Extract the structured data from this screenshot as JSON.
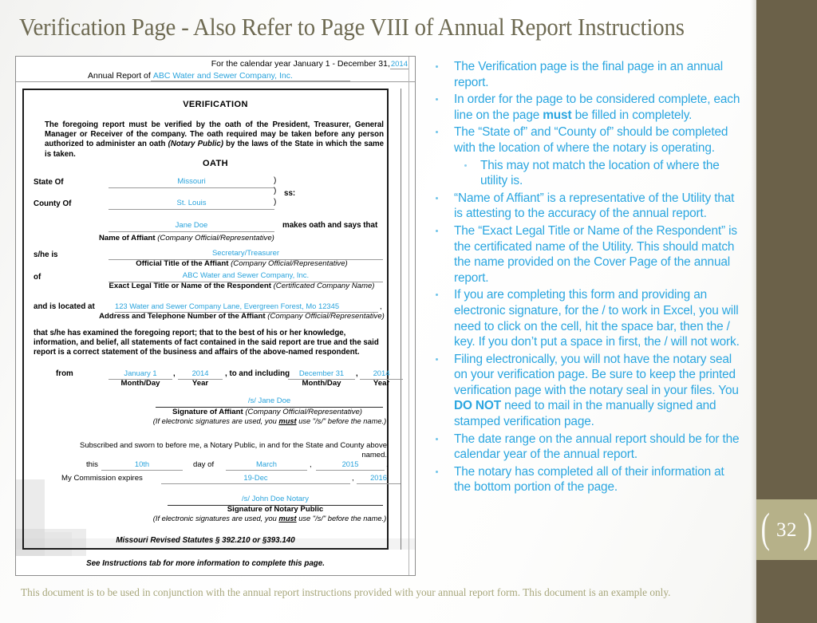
{
  "slide": {
    "title": "Verification Page - Also Refer to Page VIII of Annual Report Instructions",
    "page_number": "32",
    "bracket_left": "(",
    "bracket_right": ")",
    "footer_note": "This document is to be used in conjunction with the annual report instructions provided with your annual report form.  This document is an example only.",
    "accent_color": "#6b6149",
    "badge_color": "#b6b189",
    "title_color": "#6e6a52",
    "bullet_color": "#2ba6e0"
  },
  "form": {
    "header": {
      "calendar_year_label": "For the calendar year January 1 - December 31,",
      "calendar_year_value": "2014",
      "annual_report_label": "Annual Report of",
      "annual_report_value": "ABC Water and Sewer Company, Inc."
    },
    "verification_heading": "VERIFICATION",
    "verification_paragraph": "The foregoing report must be verified by the oath of the President, Treasurer, General Manager or Receiver of the company. The oath required may be taken before any person authorized to administer an oath (Notary Public) by the laws of the State in which the same is taken.",
    "verification_paragraph_part1": "The foregoing report must be verified by the oath of the President, Treasurer, General Manager or Receiver of the company. The oath required may be taken before any person authorized to administer an oath ",
    "verification_paragraph_italic": "(Notary Public)",
    "verification_paragraph_part2": " by the laws of the State in which the same is taken.",
    "oath_heading": "OATH",
    "state_label": "State Of",
    "state_value": "Missouri",
    "county_label": "County Of",
    "county_value": "St. Louis",
    "brace": ")",
    "ss_label": "ss:",
    "affiant_name_value": "Jane Doe",
    "makes_oath_text": "makes oath and says that",
    "affiant_caption_bold": "Name of Affiant",
    "affiant_caption_italic": "(Company Official/Representative)",
    "shehe_label": "s/he is",
    "official_title_value": "Secretary/Treasurer",
    "official_title_caption_bold": "Official Title of the Affiant",
    "official_title_caption_italic": "(Company Official/Representative)",
    "of_label": "of",
    "respondent_value": "ABC Water and Sewer Company, Inc.",
    "respondent_caption_bold": "Exact Legal Title or Name of the Respondent",
    "respondent_caption_italic": "(Certificated Company Name)",
    "located_label": "and is located at",
    "address_value": "123 Water and Sewer Company Lane, Evergreen Forest, Mo 12345",
    "address_comma": ",",
    "address_caption_bold": "Address and Telephone Number of the Affiant",
    "address_caption_italic": "(Company Official/Representative)",
    "examined_paragraph": "that s/he has examined the foregoing report; that to the best of his or her knowledge, information, and belief, all statements of fact contained in the said report are true and the said report is a correct statement of the business and affairs of the above-named respondent.",
    "from_label": "from",
    "from_monthday": "January 1",
    "from_comma": ",",
    "from_year": "2014",
    "to_and_including_label": ", to and including",
    "to_monthday": "December 31",
    "to_comma": ",",
    "to_year": "2014",
    "caption_monthday": "Month/Day",
    "caption_year": "Year",
    "signature_affiant_value": "/s/ Jane Doe",
    "signature_affiant_caption_bold": "Signature of Affiant",
    "signature_affiant_caption_italic": "(Company Official/Representative)",
    "esign_note_pre": "(If electronic signatures are used, you ",
    "esign_note_must": "must",
    "esign_note_post": " use  \"/s/\"  before the name.)",
    "subscribed_text": "Subscribed and sworn to before me, a Notary Public, in and for the State and County above named.",
    "this_label": "this",
    "this_day_value": "10th",
    "day_of_label": "day of",
    "notary_month_value": "March",
    "notary_comma": ",",
    "notary_year_value": "2015",
    "notary_period": ".",
    "commission_label": "My Commission expires",
    "commission_date_value": "19-Dec",
    "commission_comma": ",",
    "commission_year_value": "2016",
    "signature_notary_value": "/s/ John Doe Notary",
    "signature_notary_caption": "Signature of Notary Public",
    "statutes": "Missouri Revised Statutes § 392.210 or §393.140",
    "see_instructions": "See Instructions tab for more information to complete this page."
  },
  "bullets": [
    {
      "level": 1,
      "text": "The Verification page is the final page in an annual report.",
      "segments": [
        {
          "t": "The Verification page is the final page in an annual report.",
          "bold": false
        }
      ]
    },
    {
      "level": 1,
      "text": "In order for the page to be considered complete, each line on the page must be filled in completely.",
      "segments": [
        {
          "t": "In order for the page to be considered complete, each line on the page ",
          "bold": false
        },
        {
          "t": "must",
          "bold": true
        },
        {
          "t": " be filled in completely.",
          "bold": false
        }
      ]
    },
    {
      "level": 1,
      "text": "The “State of” and “County of” should be completed with the location of where the notary is operating.",
      "segments": [
        {
          "t": "The “State of” and “County of” should be completed with the location of where the notary is operating.",
          "bold": false
        }
      ]
    },
    {
      "level": 2,
      "text": "This may not match the location of where the utility is.",
      "segments": [
        {
          "t": "This may not match the location of where the utility is.",
          "bold": false
        }
      ]
    },
    {
      "level": 1,
      "text": "“Name of Affiant” is a representative of the Utility that is attesting to the accuracy of the annual report.",
      "segments": [
        {
          "t": "“Name of Affiant” is a representative of the Utility that is attesting to the accuracy of the annual report.",
          "bold": false
        }
      ]
    },
    {
      "level": 1,
      "text": "The “Exact Legal Title or Name of the Respondent” is the certificated name of the Utility.  This should match the name provided on the Cover Page of the annual report.",
      "segments": [
        {
          "t": "The “Exact Legal Title or Name of the Respondent” is the certificated name of the Utility.  This should match the name provided on the Cover Page of the annual report.",
          "bold": false
        }
      ]
    },
    {
      "level": 1,
      "text": "If you are completing this form and providing an electronic signature, for the / to work in Excel, you will need to click on the cell, hit the space bar, then the / key.  If you don’t put a space in first, the / will not work.",
      "segments": [
        {
          "t": "If you are completing this form and providing an electronic signature, for the / to work in Excel, you will need to click on the cell, hit the space bar, then the / key.  If you don’t put a space in first, the / will not work.",
          "bold": false
        }
      ]
    },
    {
      "level": 1,
      "text": "Filing electronically, you will not have the notary seal on your verification page.  Be sure to keep the printed verification page with the notary seal in your files.  You DO NOT need to mail in the manually signed and stamped verification page.",
      "segments": [
        {
          "t": "Filing electronically, you will not have the notary seal on your verification page.  Be sure to keep the printed verification page with the notary seal in your files.  You ",
          "bold": false
        },
        {
          "t": "DO NOT",
          "bold": true
        },
        {
          "t": " need to mail in the manually signed and stamped verification page.",
          "bold": false
        }
      ]
    },
    {
      "level": 1,
      "text": "The date range on the annual report should be for the calendar year of the annual report.",
      "segments": [
        {
          "t": "The date range on the annual report should be for the calendar year of the annual report.",
          "bold": false
        }
      ]
    },
    {
      "level": 1,
      "text": "The notary has completed all of their information at the bottom portion of the page.",
      "segments": [
        {
          "t": "The notary has completed all of their information at the bottom portion of the page.",
          "bold": false
        }
      ]
    }
  ]
}
